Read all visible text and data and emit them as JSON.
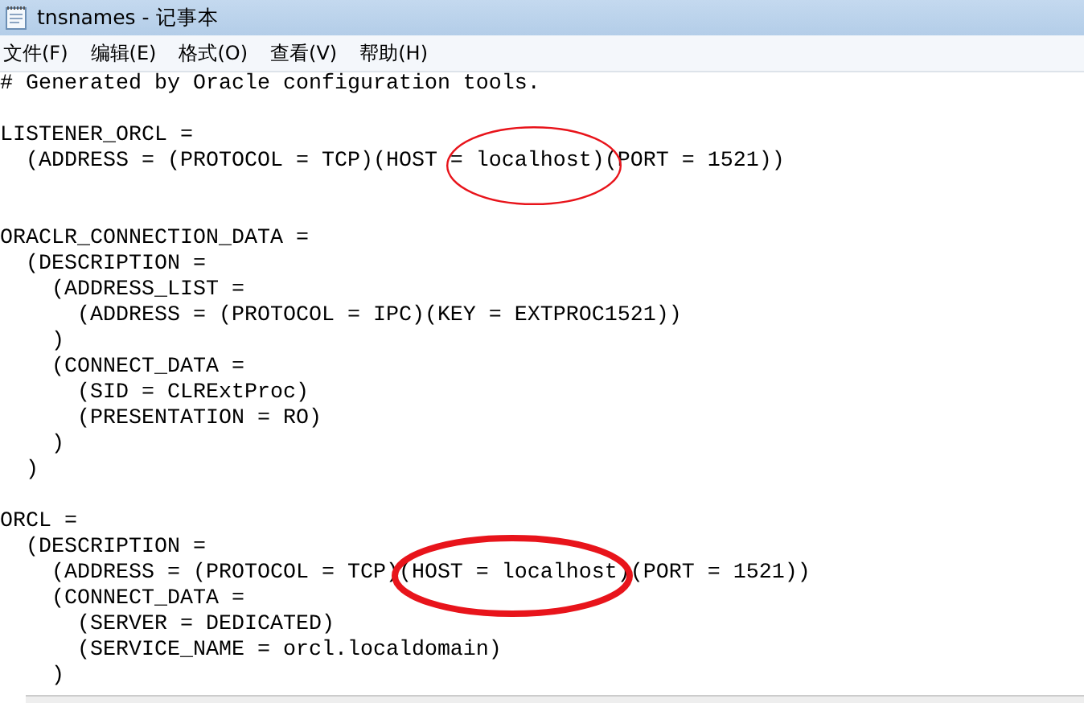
{
  "window": {
    "title": "tnsnames - 记事本"
  },
  "menu": [
    "文件(F)",
    "编辑(E)",
    "格式(O)",
    "查看(V)",
    "帮助(H)"
  ],
  "editor": {
    "text": "# Generated by Oracle configuration tools.\n\nLISTENER_ORCL =\n  (ADDRESS = (PROTOCOL = TCP)(HOST = localhost)(PORT = 1521))\n\n\nORACLR_CONNECTION_DATA =\n  (DESCRIPTION =\n    (ADDRESS_LIST =\n      (ADDRESS = (PROTOCOL = IPC)(KEY = EXTPROC1521))\n    )\n    (CONNECT_DATA =\n      (SID = CLRExtProc)\n      (PRESENTATION = RO)\n    )\n  )\n\nORCL =\n  (DESCRIPTION =\n    (ADDRESS = (PROTOCOL = TCP)(HOST = localhost)(PORT = 1521))\n    (CONNECT_DATA =\n      (SERVER = DEDICATED)\n      (SERVICE_NAME = orcl.localdomain)\n    )"
  },
  "annotations": [
    {
      "kind": "thin-ellipse"
    },
    {
      "kind": "thick-ellipse"
    }
  ]
}
